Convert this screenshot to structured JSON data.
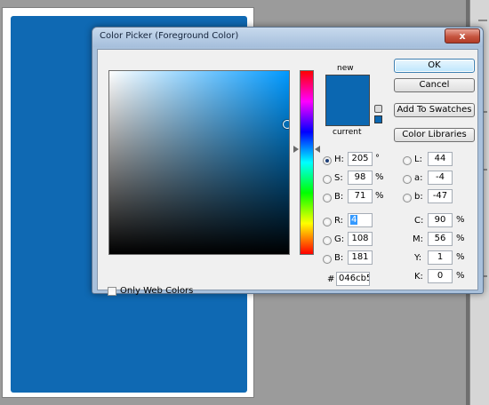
{
  "colors": {
    "canvas_fill": "#0f69b3",
    "new_color": "#0b67b1",
    "current_color": "#0b67b1",
    "field_hue": "#0099ff",
    "gamut_swatch": "#0b67b1"
  },
  "dialog": {
    "title": "Color Picker (Foreground Color)",
    "close_label": "x"
  },
  "swatch": {
    "new_label": "new",
    "current_label": "current"
  },
  "buttons": {
    "ok": "OK",
    "cancel": "Cancel",
    "add_to_swatches": "Add To Swatches",
    "color_libraries": "Color Libraries"
  },
  "hsb": {
    "h": {
      "label": "H:",
      "value": "205",
      "unit": "°",
      "selected": true
    },
    "s": {
      "label": "S:",
      "value": "98",
      "unit": "%",
      "selected": false
    },
    "b": {
      "label": "B:",
      "value": "71",
      "unit": "%",
      "selected": false
    }
  },
  "rgb": {
    "r": {
      "label": "R:",
      "value": "4"
    },
    "g": {
      "label": "G:",
      "value": "108"
    },
    "b": {
      "label": "B:",
      "value": "181"
    }
  },
  "lab": {
    "l": {
      "label": "L:",
      "value": "44"
    },
    "a": {
      "label": "a:",
      "value": "-4"
    },
    "b": {
      "label": "b:",
      "value": "-47"
    }
  },
  "cmyk": {
    "c": {
      "label": "C:",
      "value": "90",
      "unit": "%"
    },
    "m": {
      "label": "M:",
      "value": "56",
      "unit": "%"
    },
    "y": {
      "label": "Y:",
      "value": "1",
      "unit": "%"
    },
    "k": {
      "label": "K:",
      "value": "0",
      "unit": "%"
    }
  },
  "hex": {
    "label": "#",
    "value": "046cb5"
  },
  "web_colors": {
    "label": "Only Web Colors",
    "checked": false
  },
  "icons": [
    "close-icon",
    "gamut-warning-icon",
    "radio-icon",
    "checkbox-icon"
  ]
}
